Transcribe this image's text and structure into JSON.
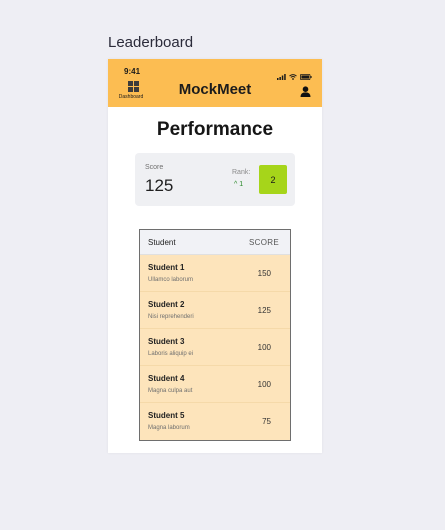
{
  "page": {
    "label": "Leaderboard"
  },
  "status_bar": {
    "time": "9:41"
  },
  "app_bar": {
    "dashboard_label": "Dashboard",
    "title": "MockMeet"
  },
  "performance": {
    "title": "Performance",
    "score_label": "Score",
    "score_value": "125",
    "rank_label": "Rank:",
    "rank_change": "^ 1",
    "rank_value": "2"
  },
  "leaderboard": {
    "columns": {
      "student": "Student",
      "score": "SCORE"
    },
    "rows": [
      {
        "name": "Student 1",
        "subtitle": "Ullamco laborum",
        "score": "150"
      },
      {
        "name": "Student 2",
        "subtitle": "Nisi reprehenderi",
        "score": "125"
      },
      {
        "name": "Student 3",
        "subtitle": "Laboris aliquip ei",
        "score": "100"
      },
      {
        "name": "Student 4",
        "subtitle": "Magna culpa aut",
        "score": "100"
      },
      {
        "name": "Student 5",
        "subtitle": "Magna laborum",
        "score": "75"
      }
    ]
  },
  "colors": {
    "app_bar": "#fcbd52",
    "rank_badge": "#a6d51a",
    "table_rows": "#fde4bb"
  }
}
